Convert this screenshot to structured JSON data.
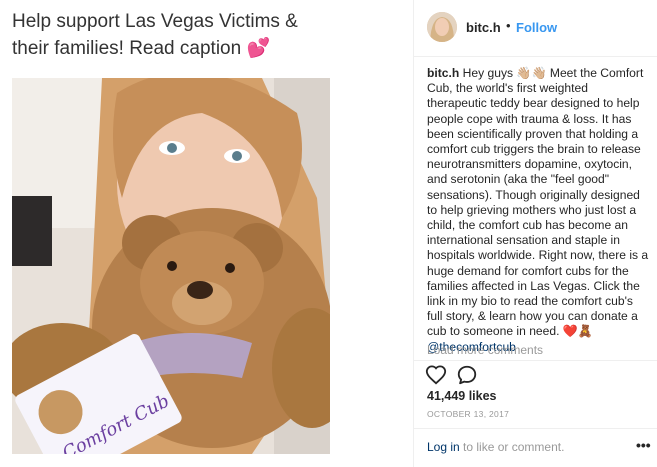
{
  "headline": {
    "text": "Help support Las Vegas Victims & their families! Read caption 💕"
  },
  "post": {
    "image_alt": "Woman holding a brown teddy bear with a Comfort Cub tag",
    "tag_text": "Comfort Cub",
    "username": "bitc.h",
    "follow_label": "Follow",
    "separator": "•",
    "caption": {
      "username": "bitc.h",
      "body": "Hey guys 👋🏼👋🏼 Meet the Comfort Cub, the world's first weighted therapeutic teddy bear designed to help people cope with trauma & loss. It has been scientifically proven that holding a comfort cub triggers the brain to release neurotransmitters dopamine, oxytocin, and serotonin (aka the \"feel good\" sensations). Though originally designed to help grieving mothers who just lost a child, the comfort cub has become an international sensation and staple in hospitals worldwide. Right now, there is a huge demand for comfort cubs for the families affected in Las Vegas. Click the link in my bio to read the comfort cub's full story, & learn how you can donate a cub to someone in need. ❤️🧸",
      "mention": "@thecomfortcub"
    },
    "load_more": "Load more comments",
    "likes": "41,449 likes",
    "date": "OCTOBER 13, 2017",
    "login_link": "Log in",
    "login_rest": " to like or comment.",
    "more_icon": "•••"
  },
  "icons": {
    "like": "heart-icon",
    "comment": "speech-bubble-icon",
    "more": "ellipsis-icon"
  },
  "colors": {
    "link_blue": "#3897f0",
    "mention_navy": "#003569",
    "muted": "#999999",
    "text": "#262626"
  }
}
